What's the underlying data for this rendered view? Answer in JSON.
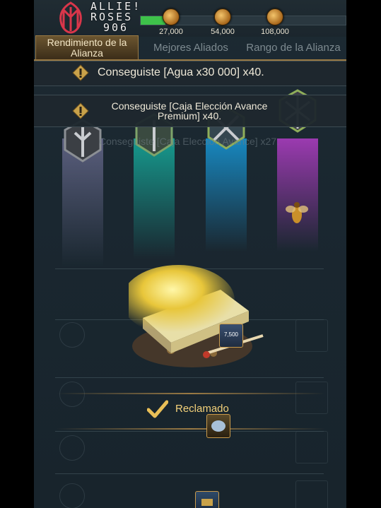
{
  "watermark": {
    "text_lines": [
      "ALLIE!",
      "ROSES",
      "906"
    ]
  },
  "header": {
    "milestones": [
      "27,000",
      "54,000",
      "108,000"
    ],
    "progress_fraction": 0.12
  },
  "tabs": [
    {
      "label": "Rendimiento de la Alianza",
      "active": true
    },
    {
      "label": "Mejores Aliados",
      "active": false
    },
    {
      "label": "Rango de la Alianza",
      "active": false
    }
  ],
  "notifications": [
    {
      "text": "Conseguiste [Agua x30 000] x40."
    },
    {
      "text": "Conseguiste [Caja Elección Avance Premium] x40."
    }
  ],
  "faded_notification": {
    "text": "Conseguiste [Caja Elección Avance] x27."
  },
  "reward": {
    "badge_value": "7,500",
    "status": "Reclamado"
  },
  "colors": {
    "accent_gold": "#9a7a44",
    "claimed_text": "#f4d27a",
    "progress_green": "#3ec24a",
    "rank_gray": "#6a6f8a",
    "rank_teal": "#1aa59a",
    "rank_blue": "#1a8fc8",
    "rank_purple": "#a13fb8"
  },
  "icons": [
    "coin-icon",
    "warning-icon",
    "rank-emblem-icon",
    "check-icon",
    "bee-icon",
    "chest-icon"
  ]
}
